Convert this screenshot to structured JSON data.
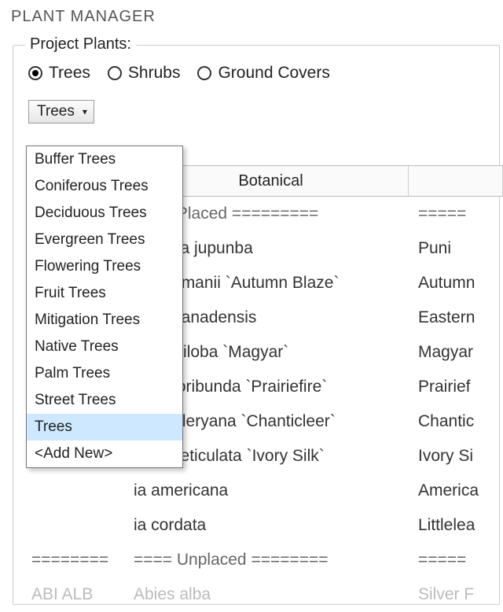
{
  "window_title": "PLANT MANAGER",
  "group_label": "Project Plants:",
  "radios": {
    "trees": "Trees",
    "shrubs": "Shrubs",
    "ground_covers": "Ground Covers",
    "selected": "trees"
  },
  "dropdown": {
    "button_label": "Trees",
    "items": [
      "Buffer Trees",
      "Coniferous Trees",
      "Deciduous Trees",
      "Evergreen Trees",
      "Flowering Trees",
      "Fruit Trees",
      "Mitigation Trees",
      "Native Trees",
      "Palm Trees",
      "Street Trees",
      "Trees",
      "<Add New>"
    ],
    "highlighted": "Trees"
  },
  "table": {
    "headers": {
      "code": "",
      "botanical": "Botanical",
      "common": ""
    },
    "rows": [
      {
        "code": "========",
        "botanical": "==== Placed =========",
        "common": "=====",
        "sep": true
      },
      {
        "code": "",
        "botanical": "parema jupunba",
        "common": "Puni"
      },
      {
        "code": "",
        "botanical": "er freemanii `Autumn Blaze`",
        "common": "Autumn"
      },
      {
        "code": "",
        "botanical": "ercis canadensis",
        "common": "Eastern"
      },
      {
        "code": "",
        "botanical": "nkgo biloba `Magyar`",
        "common": "Magyar"
      },
      {
        "code": "",
        "botanical": "alus floribunda `Prairiefire`",
        "common": "Prairief"
      },
      {
        "code": "",
        "botanical": "rus calleryana `Chanticleer`",
        "common": "Chantic"
      },
      {
        "code": "",
        "botanical": "ringa reticulata `Ivory Silk`",
        "common": "Ivory Si"
      },
      {
        "code": "",
        "botanical": "ia americana",
        "common": "America"
      },
      {
        "code": "",
        "botanical": "ia cordata",
        "common": "Littlelea"
      },
      {
        "code": "========",
        "botanical": "==== Unplaced ========",
        "common": "=====",
        "sep": true
      },
      {
        "code": "ABI ALB",
        "botanical": "Abies alba",
        "common": "Silver F",
        "faded": true
      }
    ]
  }
}
